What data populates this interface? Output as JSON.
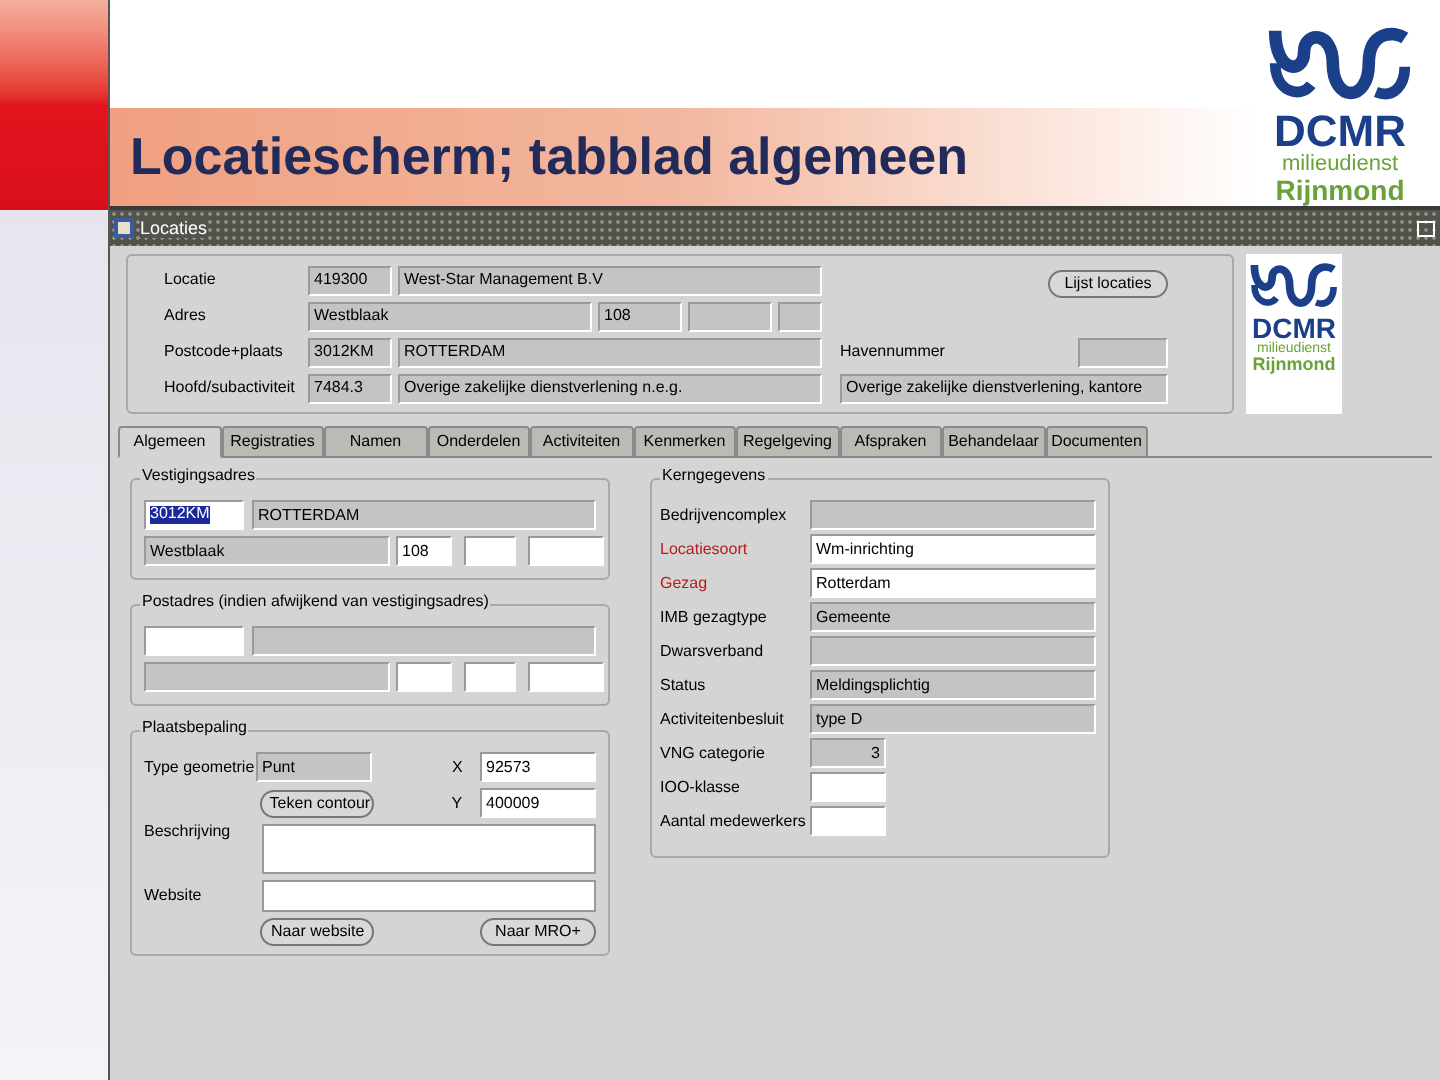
{
  "slide": {
    "title": "Locatiescherm; tabblad algemeen",
    "logo": {
      "name": "DCMR",
      "line2": "milieudienst",
      "line3": "Rijnmond"
    }
  },
  "window": {
    "title": "Locaties",
    "header": {
      "rows": [
        {
          "label": "Locatie",
          "fields": [
            {
              "value": "419300",
              "editable": false
            },
            {
              "value": "West-Star Management B.V",
              "editable": false
            }
          ]
        },
        {
          "label": "Adres",
          "fields": [
            {
              "value": "Westblaak",
              "editable": false
            },
            {
              "value": "108",
              "editable": false
            },
            {
              "editable": false
            },
            {
              "editable": false
            }
          ]
        },
        {
          "label": "Postcode+plaats",
          "fields": [
            {
              "value": "3012KM",
              "editable": false
            },
            {
              "value": "ROTTERDAM",
              "editable": false
            }
          ],
          "extra_label": "Havennummer",
          "extra_field": {
            "editable": false
          }
        },
        {
          "label": "Hoofd/subactiviteit",
          "fields": [
            {
              "value": "7484.3",
              "editable": false
            },
            {
              "value": "Overige zakelijke dienstverlening n.e.g.",
              "editable": false
            }
          ],
          "extra_field": {
            "value": "Overige zakelijke dienstverlening, kantore",
            "editable": false
          }
        }
      ],
      "list_button": "Lijst locaties",
      "logo": {
        "name": "DCMR",
        "line2": "milieudienst",
        "line3": "Rijnmond"
      }
    },
    "tabs": [
      {
        "label": "Algemeen",
        "selected": true
      },
      {
        "label": "Registraties",
        "selected": false
      },
      {
        "label": "Namen",
        "selected": false
      },
      {
        "label": "Onderdelen",
        "selected": false
      },
      {
        "label": "Activiteiten",
        "selected": false
      },
      {
        "label": "Kenmerken",
        "selected": false
      },
      {
        "label": "Regelgeving",
        "selected": false
      },
      {
        "label": "Afspraken",
        "selected": false
      },
      {
        "label": "Behandelaar",
        "selected": false
      },
      {
        "label": "Documenten",
        "selected": false
      }
    ],
    "address_groups": [
      {
        "title": "Vestigingsadres",
        "fields": [
          {
            "value": "3012KM",
            "editable": true,
            "selected": true
          },
          {
            "value": "ROTTERDAM",
            "editable": false,
            "selected": false
          },
          {
            "value": "Westblaak",
            "editable": false,
            "selected": false
          },
          {
            "value": "108",
            "editable": true,
            "selected": false
          },
          {
            "editable": true,
            "selected": false
          },
          {
            "editable": true,
            "selected": false
          }
        ]
      },
      {
        "title": "Postadres (indien afwijkend van vestigingsadres)",
        "fields": [
          {
            "editable": true,
            "selected": false
          },
          {
            "editable": false,
            "selected": false
          },
          {
            "editable": false,
            "selected": false
          },
          {
            "editable": true,
            "selected": false
          },
          {
            "editable": true,
            "selected": false
          },
          {
            "editable": true,
            "selected": false
          }
        ]
      }
    ],
    "location": {
      "title": "Plaatsbepaling",
      "geometry_label": "Type geometrie",
      "geometry": {
        "value": "Punt",
        "editable": false
      },
      "x_label": "X",
      "x": {
        "value": "92573",
        "editable": true
      },
      "y_label": "Y",
      "y": {
        "value": "400009",
        "editable": true
      },
      "draw_button": "Teken contour",
      "description_label": "Beschrijving",
      "website_label": "Website",
      "website_button": "Naar website",
      "mro_button": "Naar MRO+"
    },
    "core": {
      "title": "Kerngegevens",
      "rows": [
        {
          "label": "Bedrijvencomplex",
          "editable": false,
          "required": false
        },
        {
          "label": "Locatiesoort",
          "value": "Wm-inrichting",
          "editable": true,
          "required": true
        },
        {
          "label": "Gezag",
          "value": "Rotterdam",
          "editable": true,
          "required": true
        },
        {
          "label": "IMB gezagtype",
          "value": "Gemeente",
          "editable": false,
          "required": false
        },
        {
          "label": "Dwarsverband",
          "editable": false,
          "required": false
        },
        {
          "label": "Status",
          "value": "Meldingsplichtig",
          "editable": false,
          "required": false
        },
        {
          "label": "Activiteitenbesluit",
          "value": "type D",
          "editable": false,
          "required": false
        },
        {
          "label": "VNG categorie",
          "value": "3",
          "editable": false,
          "required": false
        },
        {
          "label": "IOO-klasse",
          "editable": true,
          "required": false
        },
        {
          "label": "Aantal medewerkers",
          "editable": true,
          "required": false
        }
      ]
    }
  }
}
